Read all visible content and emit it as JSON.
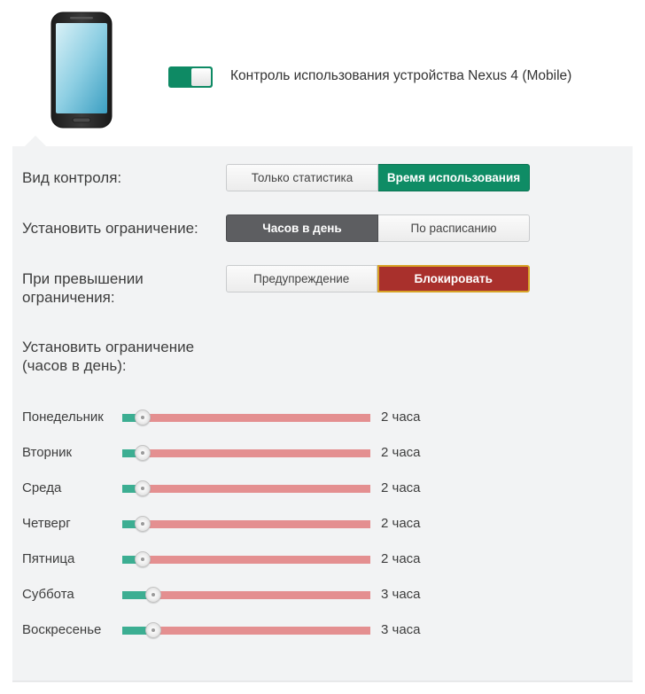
{
  "device": {
    "toggle_on": true,
    "title": "Контроль использования устройства Nexus 4 (Mobile)"
  },
  "control_type": {
    "label": "Вид контроля:",
    "options": [
      "Только статистика",
      "Время использования"
    ],
    "selected": "Время использования"
  },
  "limit": {
    "label": "Установить ограничение:",
    "options": [
      "Часов в день",
      "По расписанию"
    ],
    "selected": "Часов в день"
  },
  "on_exceed": {
    "label_line1": "При превышении",
    "label_line2": "ограничения:",
    "options": [
      "Предупреждение",
      "Блокировать"
    ],
    "selected": "Блокировать"
  },
  "hours_section": {
    "label_line1": "Установить ограничение",
    "label_line2": "(часов в день):"
  },
  "days": [
    {
      "name": "Понедельник",
      "hours": 2,
      "value_label": "2 часа"
    },
    {
      "name": "Вторник",
      "hours": 2,
      "value_label": "2 часа"
    },
    {
      "name": "Среда",
      "hours": 2,
      "value_label": "2 часа"
    },
    {
      "name": "Четверг",
      "hours": 2,
      "value_label": "2 часа"
    },
    {
      "name": "Пятница",
      "hours": 2,
      "value_label": "2 часа"
    },
    {
      "name": "Суббота",
      "hours": 3,
      "value_label": "3 часа"
    },
    {
      "name": "Воскресенье",
      "hours": 3,
      "value_label": "3 часа"
    }
  ],
  "slider_max_hours": 24,
  "colors": {
    "accent_green": "#0f8c65",
    "selected_dark": "#5d5e61",
    "block_red": "#a9302c",
    "track_remaining": "#e48f90",
    "track_used": "#3cae92",
    "panel_bg": "#f2f3f4"
  }
}
